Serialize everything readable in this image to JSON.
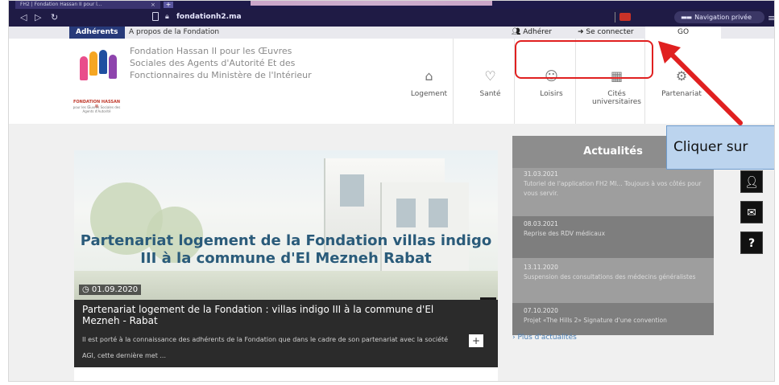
{
  "browser": {
    "tab_title": "FH2 | Fondation Hassan II pour l...",
    "tab_close": "×",
    "new_tab": "+",
    "url": "fondationh2.ma",
    "private_label": "Navigation privée",
    "icons": [
      "back-arrow-icon",
      "forward-arrow-icon",
      "reload-icon",
      "bookmark-icon",
      "lock-icon",
      "extension-icon",
      "private-mask-icon",
      "menu-icon"
    ]
  },
  "topbar": {
    "members": "Adhérents",
    "about": "A propos de la Fondation",
    "join": "Adhérer",
    "login": "Se connecter",
    "go": "GO"
  },
  "header": {
    "org_name": "Fondation Hassan II pour les Œuvres Sociales des Agents d'Autorité Et des Fonctionnaires du Ministère de l'Intérieur",
    "logo_caption": "FONDATION HASSAN II",
    "logo_subcaption": "pour les Œuvres Sociales des Agents d'Autorité",
    "menu": [
      {
        "label": "Logement",
        "icon": "housing-icon"
      },
      {
        "label": "Santé",
        "icon": "heartbeat-icon"
      },
      {
        "label": "Loisirs",
        "icon": "leisure-icon"
      },
      {
        "label": "Cités universitaires",
        "icon": "campus-icon"
      },
      {
        "label": "Partenariat",
        "icon": "partnership-icon"
      }
    ]
  },
  "hero": {
    "title": "Partenariat logement de la Fondation villas indigo III à la commune d'El Mezneh Rabat",
    "date": "01.09.2020",
    "caption_title": "Partenariat logement de la Fondation : villas indigo III à la commune d'El Mezneh - Rabat",
    "caption_body": "Il est porté à la connaissance des adhérents de la Fondation que dans le cadre de son partenariat avec la société AGI, cette dernière met ...",
    "arrows": "◀ ▶",
    "plus": "+"
  },
  "news": {
    "heading": "Actualités",
    "items": [
      {
        "date": "31.03.2021",
        "text": "Tutoriel de l'application FH2 MI... Toujours à vos côtés pour vous servir."
      },
      {
        "date": "08.03.2021",
        "text": "Reprise des RDV médicaux"
      },
      {
        "date": "13.11.2020",
        "text": "Suspension des consultations des médecins généralistes"
      },
      {
        "date": "07.10.2020",
        "text": "Projet «The Hills 2» Signature d'une convention"
      }
    ],
    "more": "› Plus d'actualités"
  },
  "side_icons": [
    "user-icon",
    "mail-icon",
    "help-icon"
  ],
  "annotation": {
    "callout": "Cliquer sur",
    "highlight_color": "#e02020",
    "arrow_color": "#e02020"
  }
}
